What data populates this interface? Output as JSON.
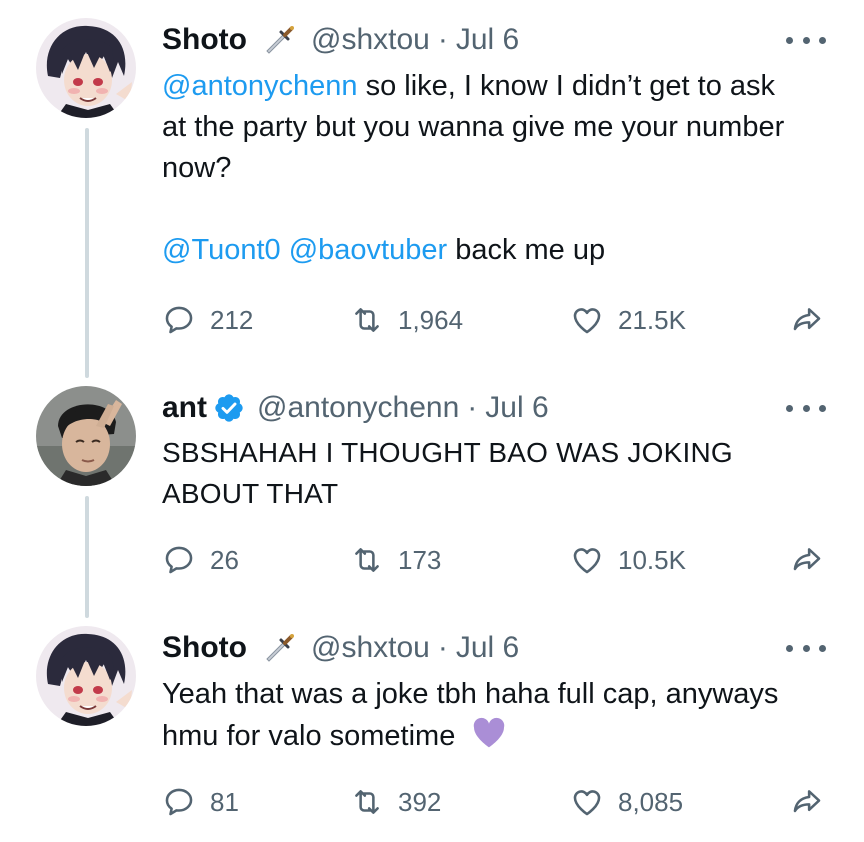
{
  "tweets": [
    {
      "name": "Shoto",
      "handle": "@shxtou",
      "separator": "·",
      "date": "Jul 6",
      "text_lines": [
        {
          "mention": "@antonychenn",
          "text": " so like, I know I didn’t get to ask"
        },
        {
          "text": "at the party but you wanna give me your number"
        },
        {
          "text": "now?"
        }
      ],
      "text_line2_mentions": [
        "@Tuont0",
        "@baovtuber"
      ],
      "text_line2_rest": " back me up",
      "replies": "212",
      "retweets": "1,964",
      "likes": "21.5K",
      "name_emoji": "dagger-icon"
    },
    {
      "name": "ant",
      "handle": "@antonychenn",
      "separator": "·",
      "date": "Jul 6",
      "text_lines": [
        {
          "text": "SBSHAHAH I THOUGHT BAO WAS JOKING"
        },
        {
          "text": "ABOUT THAT"
        }
      ],
      "replies": "26",
      "retweets": "173",
      "likes": "10.5K",
      "verified": true
    },
    {
      "name": "Shoto",
      "handle": "@shxtou",
      "separator": "·",
      "date": "Jul 6",
      "text_lines": [
        {
          "text": "Yeah that was a joke tbh haha full cap, anyways"
        },
        {
          "text": "hmu for valo sometime"
        }
      ],
      "trailing_emoji": "purple-heart-icon",
      "replies": "81",
      "retweets": "392",
      "likes": "8,085",
      "name_emoji": "dagger-icon"
    }
  ],
  "colors": {
    "text": "#0f1419",
    "secondary": "#536471",
    "link": "#1d9bf0",
    "thread_line": "#cfd9de",
    "verified": "#1d9bf0",
    "purple_heart": "#aa8ed6"
  }
}
